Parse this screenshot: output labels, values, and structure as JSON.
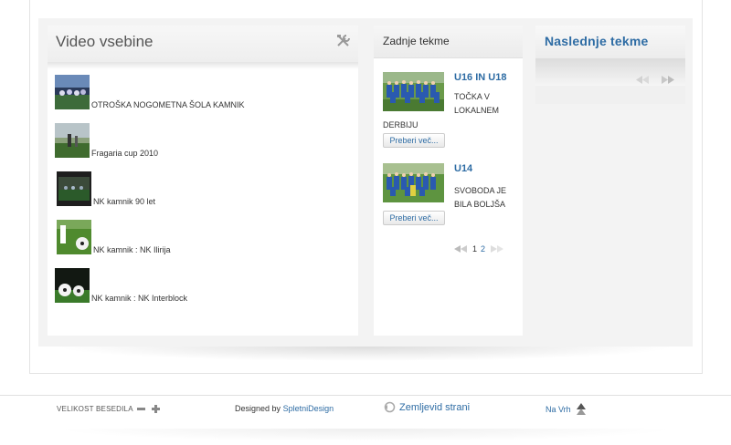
{
  "video": {
    "title": "Video vsebine",
    "items": [
      {
        "label": "OTROŠKA NOGOMETNA ŠOLA KAMNIK"
      },
      {
        "label": "Fragaria cup 2010"
      },
      {
        "label": "NK kamnik 90 let"
      },
      {
        "label": "NK kamnik : NK Ilirija"
      },
      {
        "label": "NK kamnik : NK Interblock"
      }
    ]
  },
  "zadnje": {
    "title": "Zadnje tekme",
    "matches": [
      {
        "title": "U16 IN U18",
        "line1": "TOČKA V",
        "line2": "LOKALNEM",
        "line3": "DERBIJU",
        "more": "Preberi več..."
      },
      {
        "title": "U14",
        "line1": "SVOBODA JE",
        "line2": "BILA BOLJŠA",
        "more": "Preberi več..."
      }
    ],
    "pager": {
      "page1": "1",
      "page2": "2"
    }
  },
  "naslednje": {
    "title": "Naslednje tekme"
  },
  "footer": {
    "font_size_label": "VELIKOST BESEDILA",
    "designed_by": "Designed by",
    "designer": "SpletniDesign",
    "sitemap": "Zemljevid strani",
    "to_top": "Na Vrh"
  },
  "colors": {
    "link_blue": "#2e6ca4",
    "panel_gray": "#f3f3f3"
  }
}
